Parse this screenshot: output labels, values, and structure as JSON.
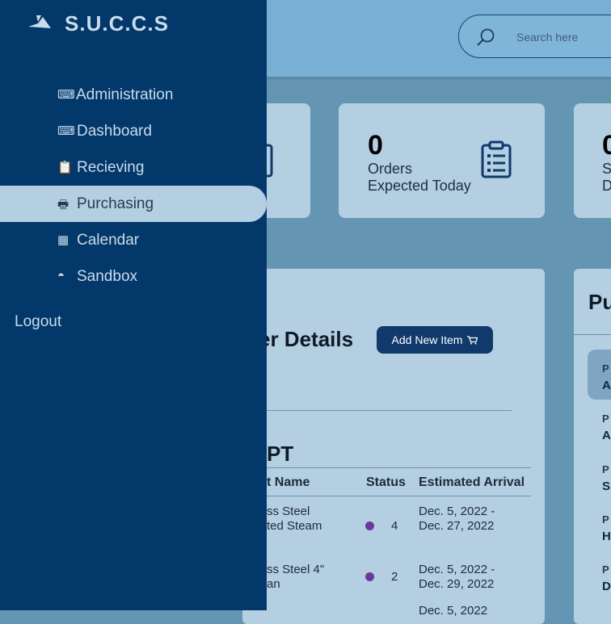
{
  "app": {
    "brand": "S.U.C.C.S"
  },
  "search": {
    "placeholder": "Search here"
  },
  "cards": [
    {
      "value": "0",
      "label_line1": "Orders",
      "label_line2": "Expected Today"
    },
    {
      "value": "0",
      "label_line1": "S",
      "label_line2": "D"
    }
  ],
  "details": {
    "title": "er Details",
    "add_button": "Add New Item",
    "section_title": "PT",
    "columns": [
      "t Name",
      "Status",
      "Estimated Arrival"
    ],
    "rows": [
      {
        "name_line1": "ss Steel",
        "name_line2": "ted Steam",
        "status": "4",
        "arrival_line1": "Dec. 5, 2022 -",
        "arrival_line2": "Dec. 27, 2022"
      },
      {
        "name_line1": "ss Steel 4\"",
        "name_line2": "an",
        "status": "2",
        "arrival_line1": "Dec. 5, 2022 -",
        "arrival_line2": "Dec. 29, 2022"
      }
    ]
  },
  "side_panel": {
    "title": "Pu",
    "items": [
      {
        "small": "P",
        "value": "A"
      },
      {
        "small": "P",
        "value": "A"
      },
      {
        "small": "P",
        "value": "S"
      },
      {
        "small": "P",
        "value": "H"
      },
      {
        "small": "P",
        "value": "D"
      }
    ]
  },
  "sidebar": {
    "items": [
      {
        "label": "Administration",
        "icon": "keyboard-icon"
      },
      {
        "label": "Dashboard",
        "icon": "keyboard-icon"
      },
      {
        "label": "Recieving",
        "icon": "clipboard-icon"
      },
      {
        "label": "Purchasing",
        "icon": "printer-icon"
      },
      {
        "label": "Calendar",
        "icon": "calendar-icon"
      },
      {
        "label": "Sandbox",
        "icon": "gauge-icon"
      }
    ],
    "active": "Purchasing",
    "logout": "Logout"
  },
  "colors": {
    "sidebar": "#03386b",
    "accent": "#0f3a6b",
    "card": "#b4cfe2",
    "status_dot": "#6a3a9a"
  }
}
